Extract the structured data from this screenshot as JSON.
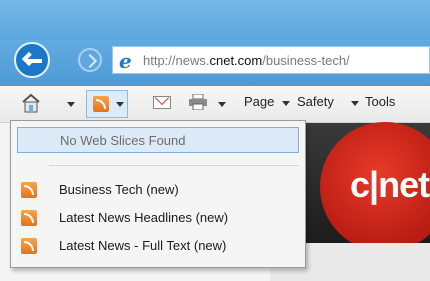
{
  "browser": {
    "address": {
      "url_prefix": "http://news.",
      "url_host": "cnet.com",
      "url_path": "/business-tech/"
    }
  },
  "command_bar": {
    "page_label": "Page",
    "safety_label": "Safety",
    "tools_label": "Tools"
  },
  "feeds_menu": {
    "no_web_slices": "No Web Slices Found",
    "items": [
      {
        "label": "Business Tech (new)"
      },
      {
        "label": "Latest News Headlines (new)"
      },
      {
        "label": "Latest News - Full Text (new)"
      }
    ]
  },
  "page": {
    "logo_text": "c|net"
  },
  "colors": {
    "chrome_blue": "#5aa6de",
    "feed_orange": "#e5721a",
    "cnet_red": "#d32a1e"
  },
  "icons": [
    "back-arrow-icon",
    "forward-arrow-icon",
    "ie-logo-icon",
    "home-icon",
    "feed-icon",
    "mail-icon",
    "print-icon",
    "chevron-down-icon"
  ]
}
